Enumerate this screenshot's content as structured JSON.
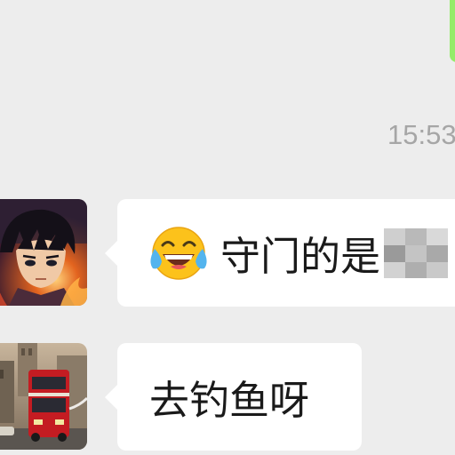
{
  "chat": {
    "timestamp": "15:53",
    "messages": [
      {
        "sender": "incoming",
        "avatar_icon": "anime-character-avatar-icon",
        "emoji_icon": "face-with-tears-of-joy-icon",
        "text": "守门的是"
      },
      {
        "sender": "incoming",
        "avatar_icon": "double-decker-bus-avatar-icon",
        "text": "去钓鱼呀"
      }
    ]
  },
  "colors": {
    "background": "#ededed",
    "incoming_bubble": "#ffffff",
    "outgoing_bubble": "#95ec69",
    "timestamp": "#a6a6a6"
  }
}
